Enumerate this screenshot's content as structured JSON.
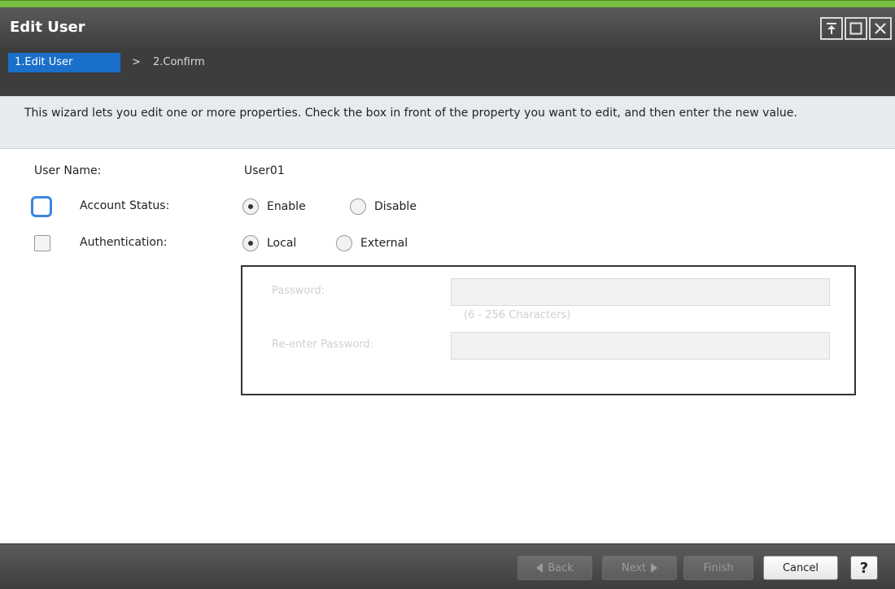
{
  "window": {
    "title": "Edit User",
    "controls": [
      "pin-icon",
      "maximize-icon",
      "close-icon"
    ]
  },
  "wizard": {
    "steps": [
      {
        "label": "1.Edit User",
        "active": true
      },
      {
        "label": "2.Confirm",
        "active": false
      }
    ],
    "separator": ">"
  },
  "info": {
    "text": "This wizard lets you edit one or more properties. Check the  box in front of the property you want to edit, and then enter the new value."
  },
  "form": {
    "user_name_label": "User Name:",
    "user_name_value": "User01",
    "account_status": {
      "label": "Account Status:",
      "checked": false,
      "focused": true,
      "options": [
        {
          "label": "Enable",
          "selected": true
        },
        {
          "label": "Disable",
          "selected": false
        }
      ]
    },
    "authentication": {
      "label": "Authentication:",
      "checked": false,
      "options": [
        {
          "label": "Local",
          "selected": true
        },
        {
          "label": "External",
          "selected": false
        }
      ]
    },
    "password": {
      "label": "Password:",
      "value": "",
      "hint": "(6 - 256 Characters)",
      "reenter_label": "Re-enter Password:",
      "reenter_value": "",
      "disabled": true
    }
  },
  "footer": {
    "back_label": "Back",
    "next_label": "Next",
    "finish_label": "Finish",
    "cancel_label": "Cancel",
    "help_label": "?"
  },
  "colors": {
    "accent_green": "#7ac143",
    "active_step_blue": "#1a6fc9",
    "focus_blue": "#3a86e0",
    "titlebar_dark": "#3f3f3f"
  }
}
